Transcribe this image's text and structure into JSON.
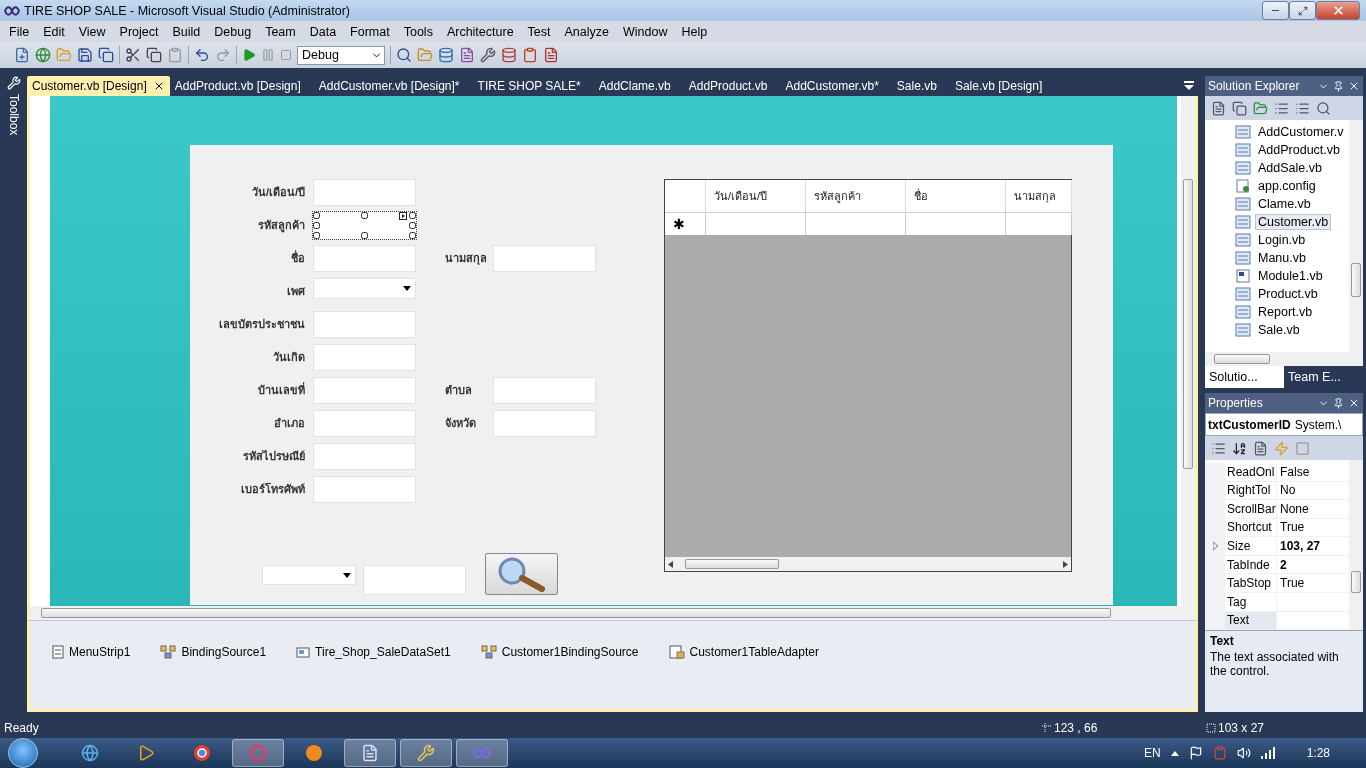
{
  "window": {
    "title": "TIRE SHOP SALE - Microsoft Visual Studio (Administrator)"
  },
  "menu": [
    "File",
    "Edit",
    "View",
    "Project",
    "Build",
    "Debug",
    "Team",
    "Data",
    "Format",
    "Tools",
    "Architecture",
    "Test",
    "Analyze",
    "Window",
    "Help"
  ],
  "toolbar": {
    "configuration": "Debug"
  },
  "toolbox": {
    "label": "Toolbox"
  },
  "tabs": [
    {
      "label": "Customer.vb [Design]",
      "selected": true
    },
    {
      "label": "AddProduct.vb [Design]",
      "selected": false
    },
    {
      "label": "AddCustomer.vb [Design]*",
      "selected": false
    },
    {
      "label": "TIRE SHOP SALE*",
      "selected": false
    },
    {
      "label": "AddClame.vb",
      "selected": false
    },
    {
      "label": "AddProduct.vb",
      "selected": false
    },
    {
      "label": "AddCustomer.vb*",
      "selected": false
    },
    {
      "label": "Sale.vb",
      "selected": false
    },
    {
      "label": "Sale.vb [Design]",
      "selected": false
    }
  ],
  "form": {
    "rows": [
      {
        "left": {
          "label": "วัน/เดือน/ปี",
          "kind": "text",
          "selected": false
        }
      },
      {
        "left": {
          "label": "รหัสลูกค้า",
          "kind": "text",
          "selected": true
        }
      },
      {
        "left": {
          "label": "ชื่อ",
          "kind": "text",
          "selected": false
        },
        "right": {
          "label": "นามสกุล",
          "kind": "text",
          "selected": false
        }
      },
      {
        "left": {
          "label": "เพศ",
          "kind": "combo",
          "selected": false
        }
      },
      {
        "left": {
          "label": "เลขบัตรประชาชน",
          "kind": "text",
          "selected": false
        }
      },
      {
        "left": {
          "label": "วันเกิด",
          "kind": "text",
          "selected": false
        }
      },
      {
        "left": {
          "label": "บ้านเลขที่",
          "kind": "text",
          "selected": false
        },
        "right": {
          "label": "ตำบล",
          "kind": "text",
          "selected": false
        }
      },
      {
        "left": {
          "label": "อำเภอ",
          "kind": "text",
          "selected": false
        },
        "right": {
          "label": "จังหวัด",
          "kind": "text",
          "selected": false
        }
      },
      {
        "left": {
          "label": "รหัสไปรษณีย์",
          "kind": "text",
          "selected": false
        }
      },
      {
        "left": {
          "label": "เบอร์โทรศัพท์",
          "kind": "text",
          "selected": false
        }
      }
    ]
  },
  "grid": {
    "columns": [
      "วัน/เดือน/ปี",
      "รหัสลูกค้า",
      "ชื่อ",
      "นามสกุล"
    ],
    "new_row_marker": "✱"
  },
  "component_tray": [
    {
      "label": "MenuStrip1",
      "kind": "menu"
    },
    {
      "label": "BindingSource1",
      "kind": "binding"
    },
    {
      "label": "Tire_Shop_SaleDataSet1",
      "kind": "dataset"
    },
    {
      "label": "Customer1BindingSource",
      "kind": "binding"
    },
    {
      "label": "Customer1TableAdapter",
      "kind": "adapter"
    }
  ],
  "solution_explorer": {
    "title": "Solution Explorer",
    "items": [
      {
        "label": "AddCustomer.v",
        "kind": "form",
        "selected": false
      },
      {
        "label": "AddProduct.vb",
        "kind": "form",
        "selected": false
      },
      {
        "label": "AddSale.vb",
        "kind": "form",
        "selected": false
      },
      {
        "label": "app.config",
        "kind": "config",
        "selected": false
      },
      {
        "label": "Clame.vb",
        "kind": "form",
        "selected": false
      },
      {
        "label": "Customer.vb",
        "kind": "form",
        "selected": true
      },
      {
        "label": "Login.vb",
        "kind": "form",
        "selected": false
      },
      {
        "label": "Manu.vb",
        "kind": "form",
        "selected": false
      },
      {
        "label": "Module1.vb",
        "kind": "module",
        "selected": false
      },
      {
        "label": "Product.vb",
        "kind": "form",
        "selected": false
      },
      {
        "label": "Report.vb",
        "kind": "form",
        "selected": false
      },
      {
        "label": "Sale.vb",
        "kind": "form",
        "selected": false
      }
    ],
    "tabs": [
      {
        "label": "Solutio...",
        "selected": true
      },
      {
        "label": "Team E...",
        "selected": false
      }
    ]
  },
  "properties": {
    "title": "Properties",
    "object": "txtCustomerID",
    "type": "System.\\",
    "rows": [
      {
        "name": "ReadOnl",
        "value": "False",
        "expandable": false,
        "selected": false
      },
      {
        "name": "RightTol",
        "value": "No",
        "expandable": false,
        "selected": false
      },
      {
        "name": "ScrollBar",
        "value": "None",
        "expandable": false,
        "selected": false
      },
      {
        "name": "Shortcut",
        "value": "True",
        "expandable": false,
        "selected": false
      },
      {
        "name": "Size",
        "value": "103, 27",
        "bold": true,
        "expandable": true,
        "selected": false
      },
      {
        "name": "TabInde",
        "value": "2",
        "bold": true,
        "expandable": false,
        "selected": false
      },
      {
        "name": "TabStop",
        "value": "True",
        "expandable": false,
        "selected": false
      },
      {
        "name": "Tag",
        "expandable": false,
        "selected": false
      },
      {
        "name": "Text",
        "expandable": false,
        "selected": true
      }
    ],
    "description": {
      "title": "Text",
      "text": "The text associated with the control."
    }
  },
  "status_bar": {
    "text": "Ready",
    "position": "123 , 66",
    "size": "103 x 27"
  },
  "taskbar": {
    "language": "EN",
    "time": "1:28"
  }
}
